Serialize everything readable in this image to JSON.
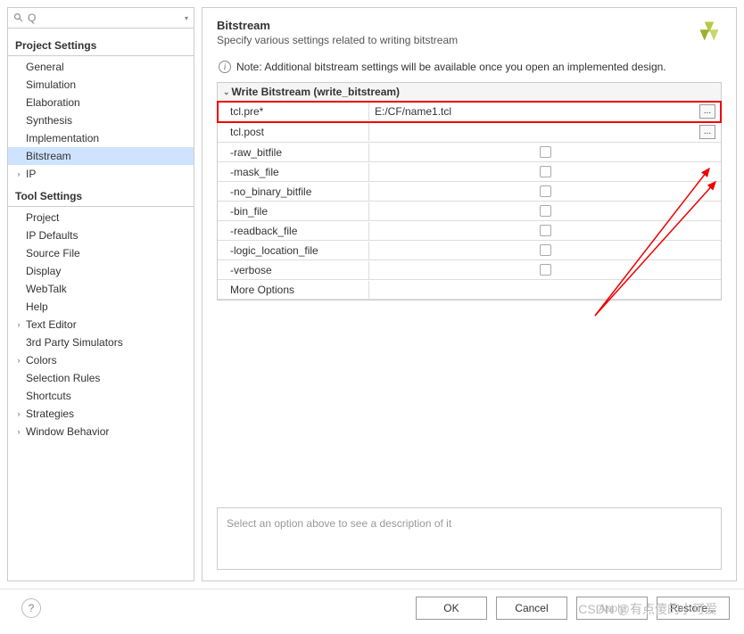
{
  "search": {
    "placeholder": "Q-"
  },
  "sidebar": {
    "section1": {
      "title": "Project Settings"
    },
    "items1": [
      {
        "label": "General"
      },
      {
        "label": "Simulation"
      },
      {
        "label": "Elaboration"
      },
      {
        "label": "Synthesis"
      },
      {
        "label": "Implementation"
      },
      {
        "label": "Bitstream"
      },
      {
        "label": "IP"
      }
    ],
    "section2": {
      "title": "Tool Settings"
    },
    "items2": [
      {
        "label": "Project"
      },
      {
        "label": "IP Defaults"
      },
      {
        "label": "Source File"
      },
      {
        "label": "Display"
      },
      {
        "label": "WebTalk"
      },
      {
        "label": "Help"
      },
      {
        "label": "Text Editor"
      },
      {
        "label": "3rd Party Simulators"
      },
      {
        "label": "Colors"
      },
      {
        "label": "Selection Rules"
      },
      {
        "label": "Shortcuts"
      },
      {
        "label": "Strategies"
      },
      {
        "label": "Window Behavior"
      }
    ]
  },
  "panel": {
    "title": "Bitstream",
    "subtitle": "Specify various settings related to writing bitstream",
    "note": "Note: Additional bitstream settings will be available once you open an implemented design.",
    "group_title": "Write Bitstream (write_bitstream)",
    "rows": [
      {
        "name": "tcl.pre*",
        "value": "E:/CF/name1.tcl",
        "type": "browse"
      },
      {
        "name": "tcl.post",
        "value": "",
        "type": "browse"
      },
      {
        "name": "-raw_bitfile",
        "type": "check"
      },
      {
        "name": "-mask_file",
        "type": "check"
      },
      {
        "name": "-no_binary_bitfile",
        "type": "check"
      },
      {
        "name": "-bin_file",
        "type": "check"
      },
      {
        "name": "-readback_file",
        "type": "check"
      },
      {
        "name": "-logic_location_file",
        "type": "check"
      },
      {
        "name": "-verbose",
        "type": "check"
      },
      {
        "name": "More Options",
        "type": "text"
      }
    ],
    "description_placeholder": "Select an option above to see a description of it",
    "browse_label": "..."
  },
  "buttons": {
    "ok": "OK",
    "cancel": "Cancel",
    "apply": "Apply",
    "restore": "Restore..."
  },
  "watermark": "CSDN @有点傻的小可爱",
  "help": "?"
}
